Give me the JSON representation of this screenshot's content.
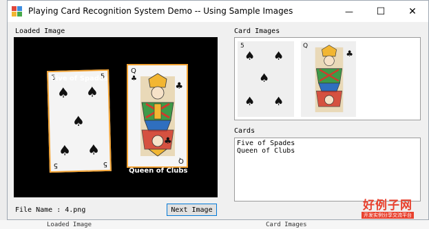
{
  "window": {
    "title": "Playing Card Recognition System Demo -- Using Sample Images",
    "minimize_glyph": "—",
    "maximize_glyph": "☐",
    "close_glyph": "✕"
  },
  "loaded_image": {
    "label": "Loaded Image",
    "cards": [
      {
        "name": "Five of Spades",
        "rank": "5",
        "suit": "♠"
      },
      {
        "name": "Queen of Clubs",
        "rank": "Q",
        "suit": "♣"
      }
    ]
  },
  "file_name": {
    "label": "File Name : 4.png"
  },
  "next_button": {
    "label": "Next Image"
  },
  "card_images": {
    "label": "Card Images",
    "thumbs": [
      {
        "rank": "5",
        "suit": "♠"
      },
      {
        "rank": "Q",
        "suit": "♣"
      }
    ]
  },
  "cards_list": {
    "label": "Cards",
    "items": [
      "Five of Spades",
      "Queen of Clubs"
    ]
  },
  "background_window": {
    "loaded_label": "Loaded Image",
    "card_images_label": "Card Images"
  },
  "watermark": {
    "logo_text": "好例子网",
    "logo_sub": "开发实例分享交流平台"
  },
  "colors": {
    "card_border": "#f3a333",
    "button_border": "#0078d7",
    "logo_red": "#e8412e"
  }
}
